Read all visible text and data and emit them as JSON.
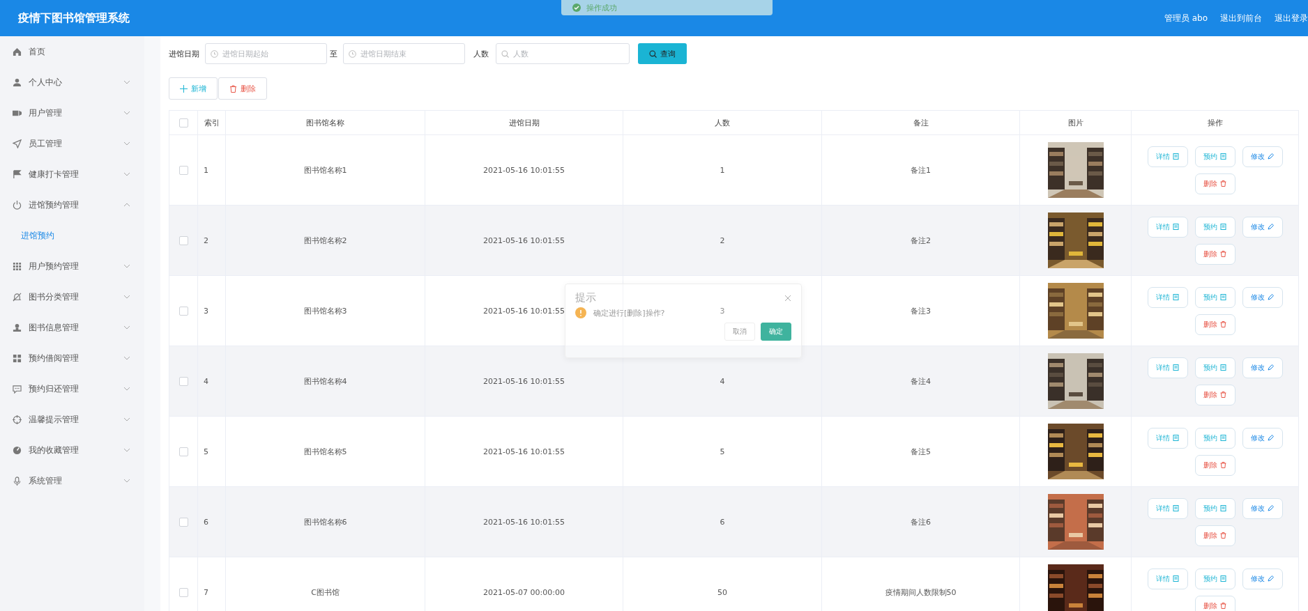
{
  "header": {
    "title": "疫情下图书馆管理系统",
    "user": "管理员 abo",
    "links": [
      "退出到前台",
      "退出登录"
    ]
  },
  "toast": {
    "message": "操作成功"
  },
  "sidebar": {
    "items": [
      {
        "label": "首页",
        "kind": "link",
        "selected": false
      },
      {
        "label": "个人中心",
        "kind": "submenu",
        "expanded": false
      },
      {
        "label": "用户管理",
        "kind": "submenu",
        "expanded": false
      },
      {
        "label": "员工管理",
        "kind": "submenu",
        "expanded": false
      },
      {
        "label": "健康打卡管理",
        "kind": "submenu",
        "expanded": false
      },
      {
        "label": "进馆预约管理",
        "kind": "submenu",
        "expanded": true,
        "children": [
          {
            "label": "进馆预约",
            "selected": true
          }
        ]
      },
      {
        "label": "用户预约管理",
        "kind": "submenu",
        "expanded": false
      },
      {
        "label": "图书分类管理",
        "kind": "submenu",
        "expanded": false
      },
      {
        "label": "图书信息管理",
        "kind": "submenu",
        "expanded": false
      },
      {
        "label": "预约借阅管理",
        "kind": "submenu",
        "expanded": false
      },
      {
        "label": "预约归还管理",
        "kind": "submenu",
        "expanded": false
      },
      {
        "label": "温馨提示管理",
        "kind": "submenu",
        "expanded": false
      },
      {
        "label": "我的收藏管理",
        "kind": "submenu",
        "expanded": false
      },
      {
        "label": "系统管理",
        "kind": "submenu",
        "expanded": false
      }
    ]
  },
  "filters": [
    {
      "label": "进馆日期",
      "kind": "date",
      "placeholder": "进馆日期起始"
    },
    {
      "label": "至",
      "kind": "date",
      "placeholder": "进馆日期结束"
    },
    {
      "label": "人数",
      "kind": "search",
      "placeholder": "人数"
    }
  ],
  "search_button": "查询",
  "toolbar": [
    {
      "label": "新增",
      "kind": "add"
    },
    {
      "label": "删除",
      "kind": "delete"
    }
  ],
  "table": {
    "select_all": {
      "checked": false
    },
    "columns": [
      "索引",
      "图书馆名称",
      "进馆日期",
      "人数",
      "备注",
      "图片",
      "操作"
    ],
    "rows": [
      {
        "checked": false,
        "cells": [
          "1",
          "图书馆名称1",
          "2021-05-16 10:01:55",
          "1",
          "备注1"
        ],
        "actions": [
          {
            "label": "详情",
            "kind": "info"
          },
          {
            "label": "预约",
            "kind": "info"
          },
          {
            "label": "修改",
            "kind": "edit"
          },
          {
            "label": "删除",
            "kind": "danger"
          }
        ]
      },
      {
        "checked": false,
        "cells": [
          "2",
          "图书馆名称2",
          "2021-05-16 10:01:55",
          "2",
          "备注2"
        ],
        "actions": [
          {
            "label": "详情",
            "kind": "info"
          },
          {
            "label": "预约",
            "kind": "info"
          },
          {
            "label": "修改",
            "kind": "edit"
          },
          {
            "label": "删除",
            "kind": "danger"
          }
        ]
      },
      {
        "checked": false,
        "cells": [
          "3",
          "图书馆名称3",
          "2021-05-16 10:01:55",
          "3",
          "备注3"
        ],
        "actions": [
          {
            "label": "详情",
            "kind": "info"
          },
          {
            "label": "预约",
            "kind": "info"
          },
          {
            "label": "修改",
            "kind": "edit"
          },
          {
            "label": "删除",
            "kind": "danger"
          }
        ]
      },
      {
        "checked": false,
        "cells": [
          "4",
          "图书馆名称4",
          "2021-05-16 10:01:55",
          "4",
          "备注4"
        ],
        "actions": [
          {
            "label": "详情",
            "kind": "info"
          },
          {
            "label": "预约",
            "kind": "info"
          },
          {
            "label": "修改",
            "kind": "edit"
          },
          {
            "label": "删除",
            "kind": "danger"
          }
        ]
      },
      {
        "checked": false,
        "cells": [
          "5",
          "图书馆名称5",
          "2021-05-16 10:01:55",
          "5",
          "备注5"
        ],
        "actions": [
          {
            "label": "详情",
            "kind": "info"
          },
          {
            "label": "预约",
            "kind": "info"
          },
          {
            "label": "修改",
            "kind": "edit"
          },
          {
            "label": "删除",
            "kind": "danger"
          }
        ]
      },
      {
        "checked": false,
        "cells": [
          "6",
          "图书馆名称6",
          "2021-05-16 10:01:55",
          "6",
          "备注6"
        ],
        "actions": [
          {
            "label": "详情",
            "kind": "info"
          },
          {
            "label": "预约",
            "kind": "info"
          },
          {
            "label": "修改",
            "kind": "edit"
          },
          {
            "label": "删除",
            "kind": "danger"
          }
        ]
      },
      {
        "checked": false,
        "cells": [
          "7",
          "C图书馆",
          "2021-05-07 00:00:00",
          "50",
          "疫情期间人数限制50"
        ],
        "actions": [
          {
            "label": "详情",
            "kind": "info"
          },
          {
            "label": "预约",
            "kind": "info"
          },
          {
            "label": "修改",
            "kind": "edit"
          },
          {
            "label": "删除",
            "kind": "danger"
          }
        ]
      }
    ]
  },
  "dialog": {
    "title": "提示",
    "message": "确定进行[删除]操作?",
    "buttons": [
      {
        "label": "取消",
        "kind": "cancel"
      },
      {
        "label": "确定",
        "kind": "primary"
      }
    ]
  }
}
